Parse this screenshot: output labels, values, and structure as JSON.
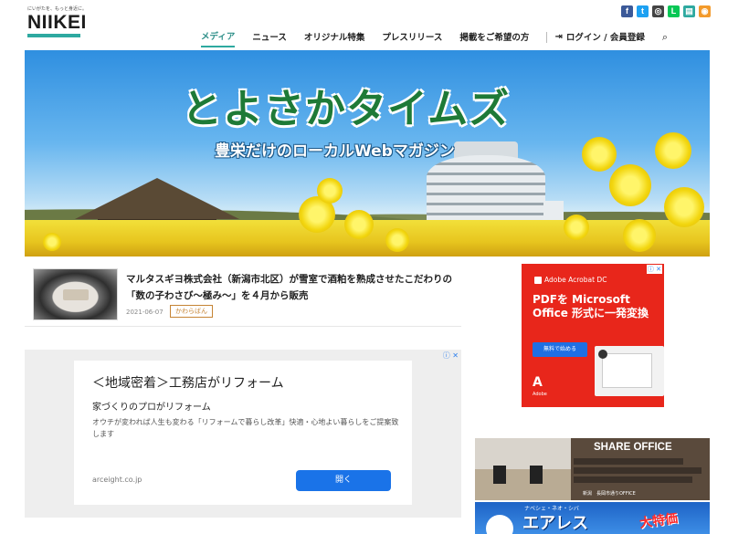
{
  "header": {
    "tagline": "にいがたを、もっと身近に。",
    "logo_text": "NIIKEI",
    "nav": [
      {
        "label": "メディア",
        "active": true
      },
      {
        "label": "ニュース",
        "active": false
      },
      {
        "label": "オリジナル特集",
        "active": false
      },
      {
        "label": "プレスリリース",
        "active": false
      },
      {
        "label": "掲載をご希望の方",
        "active": false
      }
    ],
    "login_label": "ログイン / 会員登録",
    "social": [
      {
        "name": "facebook-icon",
        "glyph": "f",
        "color": "#3b5998"
      },
      {
        "name": "twitter-icon",
        "glyph": "t",
        "color": "#1da1f2"
      },
      {
        "name": "instagram-icon",
        "glyph": "◎",
        "color": "#444444"
      },
      {
        "name": "line-icon",
        "glyph": "L",
        "color": "#06c755"
      },
      {
        "name": "note-icon",
        "glyph": "▤",
        "color": "#2ea9a0"
      },
      {
        "name": "rss-icon",
        "glyph": "◉",
        "color": "#f39a2b"
      }
    ]
  },
  "hero": {
    "title": "とよさかタイムズ",
    "subtitle": "豊栄だけのローカルWebマガジン"
  },
  "article": {
    "headline": "マルタスギヨ株式会社（新潟市北区）が雪室で酒粕を熟成させたこだわりの「数の子わさび〜極み〜」を４月から販売",
    "date": "2021-06-07",
    "tag": "かわらばん"
  },
  "ad_left": {
    "corner": "ⓘ ✕",
    "title": "＜地域密着＞工務店がリフォーム",
    "subtitle": "家づくりのプロがリフォーム",
    "description": "オウチが変われば人生も変わる「リフォームで暮らし改革」快適・心地よい暮らしをご提案致します",
    "domain": "arceight.co.jp",
    "button": "開く"
  },
  "ad_adobe": {
    "corner": "ⓘ ✕",
    "product": "Adobe Acrobat DC",
    "headline": "PDFを Microsoft Office 形式に一発変換",
    "button": "無料で始める",
    "logo_mark": "A",
    "logo_text": "Adobe"
  },
  "ad_office": {
    "title": "SHARE OFFICE",
    "footer": "新潟　長岡市通りOFFICE"
  },
  "ad_bottom": {
    "line1": "ナベシェ・ネオ・シバ",
    "line2": "エアレス",
    "line3": "大特価"
  },
  "colors": {
    "accent": "#2ea9a0",
    "adobe_red": "#e8261b",
    "ad_button": "#1a73e8",
    "tag_color": "#c58434"
  }
}
